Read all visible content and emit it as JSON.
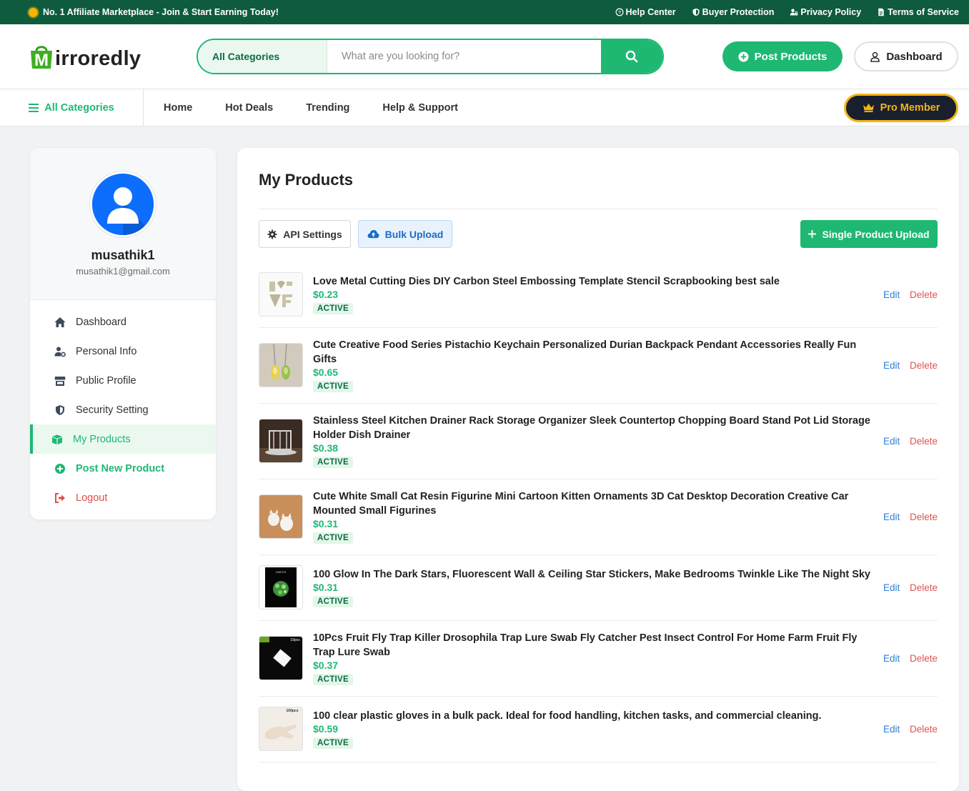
{
  "topbar": {
    "promo": "No. 1 Affiliate Marketplace - Join & Start Earning Today!",
    "links": [
      "Help Center",
      "Buyer Protection",
      "Privacy Policy",
      "Terms of Service"
    ]
  },
  "header": {
    "logo_initial": "M",
    "logo_text": "irroredly",
    "search_category": "All Categories",
    "search_placeholder": "What are you looking for?",
    "post_products": "Post Products",
    "dashboard": "Dashboard"
  },
  "nav": {
    "all_categories": "All Categories",
    "links": [
      "Home",
      "Hot Deals",
      "Trending",
      "Help & Support"
    ],
    "pro_member": "Pro Member"
  },
  "sidebar": {
    "username": "musathik1",
    "email": "musathik1@gmail.com",
    "items": [
      {
        "label": "Dashboard",
        "icon": "home-icon"
      },
      {
        "label": "Personal Info",
        "icon": "user-cog-icon"
      },
      {
        "label": "Public Profile",
        "icon": "store-icon"
      },
      {
        "label": "Security Setting",
        "icon": "shield-icon"
      },
      {
        "label": "My Products",
        "icon": "boxes-icon"
      },
      {
        "label": "Post New Product",
        "icon": "plus-circle-icon"
      },
      {
        "label": "Logout",
        "icon": "logout-icon"
      }
    ],
    "active": "My Products"
  },
  "main": {
    "title": "My Products",
    "api_settings": "API Settings",
    "bulk_upload": "Bulk Upload",
    "single_upload": "Single Product Upload",
    "edit_label": "Edit",
    "delete_label": "Delete",
    "products": [
      {
        "title": "Love Metal Cutting Dies DIY Carbon Steel Embossing Template Stencil Scrapbooking best sale",
        "price": "$0.23",
        "status": "ACTIVE",
        "thumb": "metal-die"
      },
      {
        "title": "Cute Creative Food Series Pistachio Keychain Personalized Durian Backpack Pendant Accessories Really Fun Gifts",
        "price": "$0.65",
        "status": "ACTIVE",
        "thumb": "keychain"
      },
      {
        "title": "Stainless Steel Kitchen Drainer Rack Storage Organizer Sleek Countertop Chopping Board Stand Pot Lid Storage Holder Dish Drainer",
        "price": "$0.38",
        "status": "ACTIVE",
        "thumb": "rack"
      },
      {
        "title": "Cute White Small Cat Resin Figurine Mini Cartoon Kitten Ornaments 3D Cat Desktop Decoration Creative Car Mounted Small Figurines",
        "price": "$0.31",
        "status": "ACTIVE",
        "thumb": "cats"
      },
      {
        "title": "100 Glow In The Dark Stars, Fluorescent Wall & Ceiling Star Stickers, Make Bedrooms Twinkle Like The Night Sky",
        "price": "$0.31",
        "status": "ACTIVE",
        "thumb": "stars",
        "thumb_label": "100PCS"
      },
      {
        "title": "10Pcs Fruit Fly Trap Killer Drosophila Trap Lure Swab Fly Catcher Pest Insect Control For Home Farm Fruit Fly Trap Lure Swab",
        "price": "$0.37",
        "status": "ACTIVE",
        "thumb": "flytrap",
        "thumb_label": "10pcs"
      },
      {
        "title": "100 clear plastic gloves in a bulk pack. Ideal for food handling, kitchen tasks, and commercial cleaning.",
        "price": "$0.59",
        "status": "ACTIVE",
        "thumb": "gloves",
        "thumb_label": "100pcs"
      }
    ]
  },
  "colors": {
    "brand_green": "#1eb873",
    "dark_green": "#0e5b3d",
    "pro_gold": "#f2b418",
    "edit_blue": "#2f7fd8",
    "delete_red": "#e05353"
  }
}
